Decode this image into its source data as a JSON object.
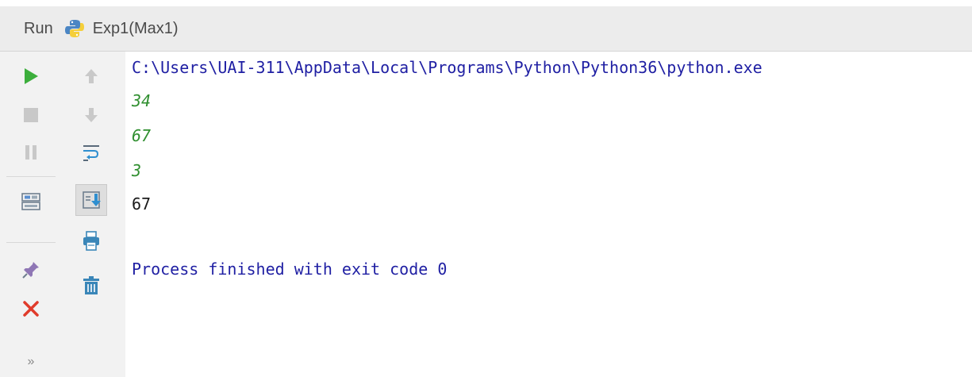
{
  "header": {
    "tool_window_label": "Run",
    "run_config_name": "Exp1(Max1)",
    "config_icon": "python-icon"
  },
  "toolbar_left": [
    {
      "name": "run-icon",
      "tooltip": "Rerun",
      "color": "#3cae3c"
    },
    {
      "name": "stop-icon",
      "tooltip": "Stop",
      "color": "#c8c8c8"
    },
    {
      "name": "pause-icon",
      "tooltip": "Pause",
      "color": "#c8c8c8"
    },
    {
      "name": "restore-layout-icon",
      "tooltip": "Restore layout"
    },
    {
      "name": "pin-icon",
      "tooltip": "Pin tab"
    },
    {
      "name": "close-icon",
      "tooltip": "Close",
      "color": "#e03b2b"
    },
    {
      "name": "more-icon",
      "label": "»"
    }
  ],
  "toolbar_right": [
    {
      "name": "up-arrow-icon",
      "tooltip": "Up the stack trace"
    },
    {
      "name": "down-arrow-icon",
      "tooltip": "Down the stack trace"
    },
    {
      "name": "soft-wrap-icon",
      "tooltip": "Use soft wraps"
    },
    {
      "name": "scroll-to-end-icon",
      "tooltip": "Scroll to the end"
    },
    {
      "name": "print-icon",
      "tooltip": "Print"
    },
    {
      "name": "trash-icon",
      "tooltip": "Clear all"
    }
  ],
  "console": {
    "command_line": "C:\\Users\\UAI-311\\AppData\\Local\\Programs\\Python\\Python36\\python.exe",
    "inputs": [
      "34",
      "67",
      "3"
    ],
    "output": "67",
    "exit_message": "Process finished with exit code 0"
  },
  "colors": {
    "command": "#1f1fa3",
    "user_input": "#2f8f2f",
    "stdout": "#1a1a1a"
  }
}
